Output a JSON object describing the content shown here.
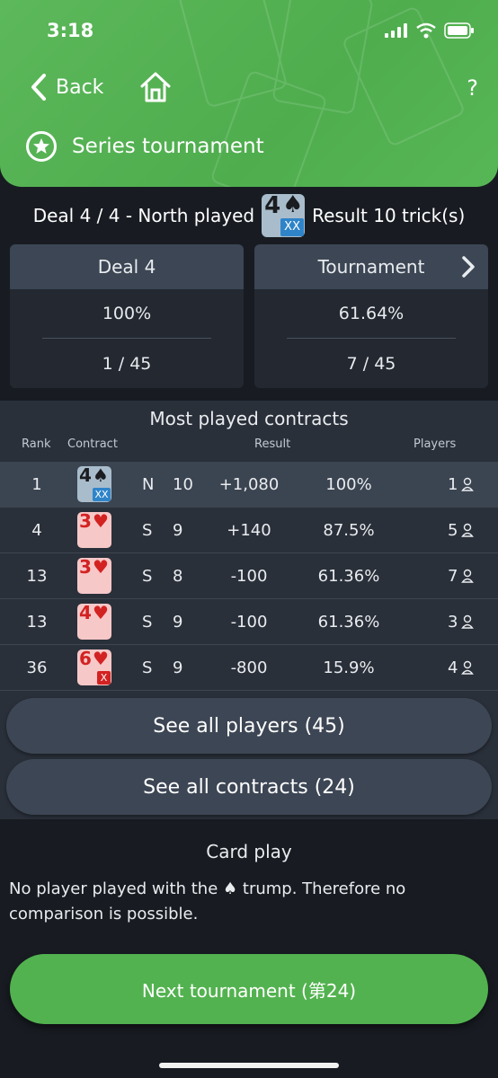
{
  "status": {
    "time": "3:18"
  },
  "nav": {
    "back_label": "Back",
    "help_label": "?"
  },
  "header": {
    "title": "Series tournament"
  },
  "deal_line": {
    "prefix": "Deal 4 / 4 - North played",
    "contract_level": "4",
    "contract_suit": "♠",
    "contract_double": "XX",
    "result": "Result 10 trick(s)"
  },
  "stats": {
    "deal": {
      "header": "Deal 4",
      "percent": "100%",
      "rank": "1 / 45"
    },
    "tournament": {
      "header": "Tournament",
      "percent": "61.64%",
      "rank": "7 / 45"
    }
  },
  "contracts": {
    "title": "Most played contracts",
    "columns": {
      "rank": "Rank",
      "contract": "Contract",
      "result": "Result",
      "players": "Players"
    },
    "rows": [
      {
        "rank": "1",
        "level": "4",
        "suit": "♠",
        "double": "XX",
        "color": "blue",
        "declarer": "N",
        "tricks": "10",
        "score": "+1,080",
        "percent": "100%",
        "players": "1"
      },
      {
        "rank": "4",
        "level": "3",
        "suit": "♥",
        "double": "",
        "color": "red",
        "declarer": "S",
        "tricks": "9",
        "score": "+140",
        "percent": "87.5%",
        "players": "5"
      },
      {
        "rank": "13",
        "level": "3",
        "suit": "♥",
        "double": "",
        "color": "red",
        "declarer": "S",
        "tricks": "8",
        "score": "-100",
        "percent": "61.36%",
        "players": "7"
      },
      {
        "rank": "13",
        "level": "4",
        "suit": "♥",
        "double": "",
        "color": "red",
        "declarer": "S",
        "tricks": "9",
        "score": "-100",
        "percent": "61.36%",
        "players": "3"
      },
      {
        "rank": "36",
        "level": "6",
        "suit": "♥",
        "double": "X",
        "color": "red",
        "declarer": "S",
        "tricks": "9",
        "score": "-800",
        "percent": "15.9%",
        "players": "4"
      }
    ],
    "see_players": "See all players (45)",
    "see_contracts": "See all contracts (24)"
  },
  "card_play": {
    "title": "Card play",
    "message_part1": "No player played with the",
    "message_suit": "♠",
    "message_part2": "trump. Therefore no comparison is possible."
  },
  "next_button": "Next tournament (第24)",
  "colors": {
    "header_green": "#52b24f",
    "double_blue": "#2f84c9",
    "heart_red": "#d32222"
  }
}
